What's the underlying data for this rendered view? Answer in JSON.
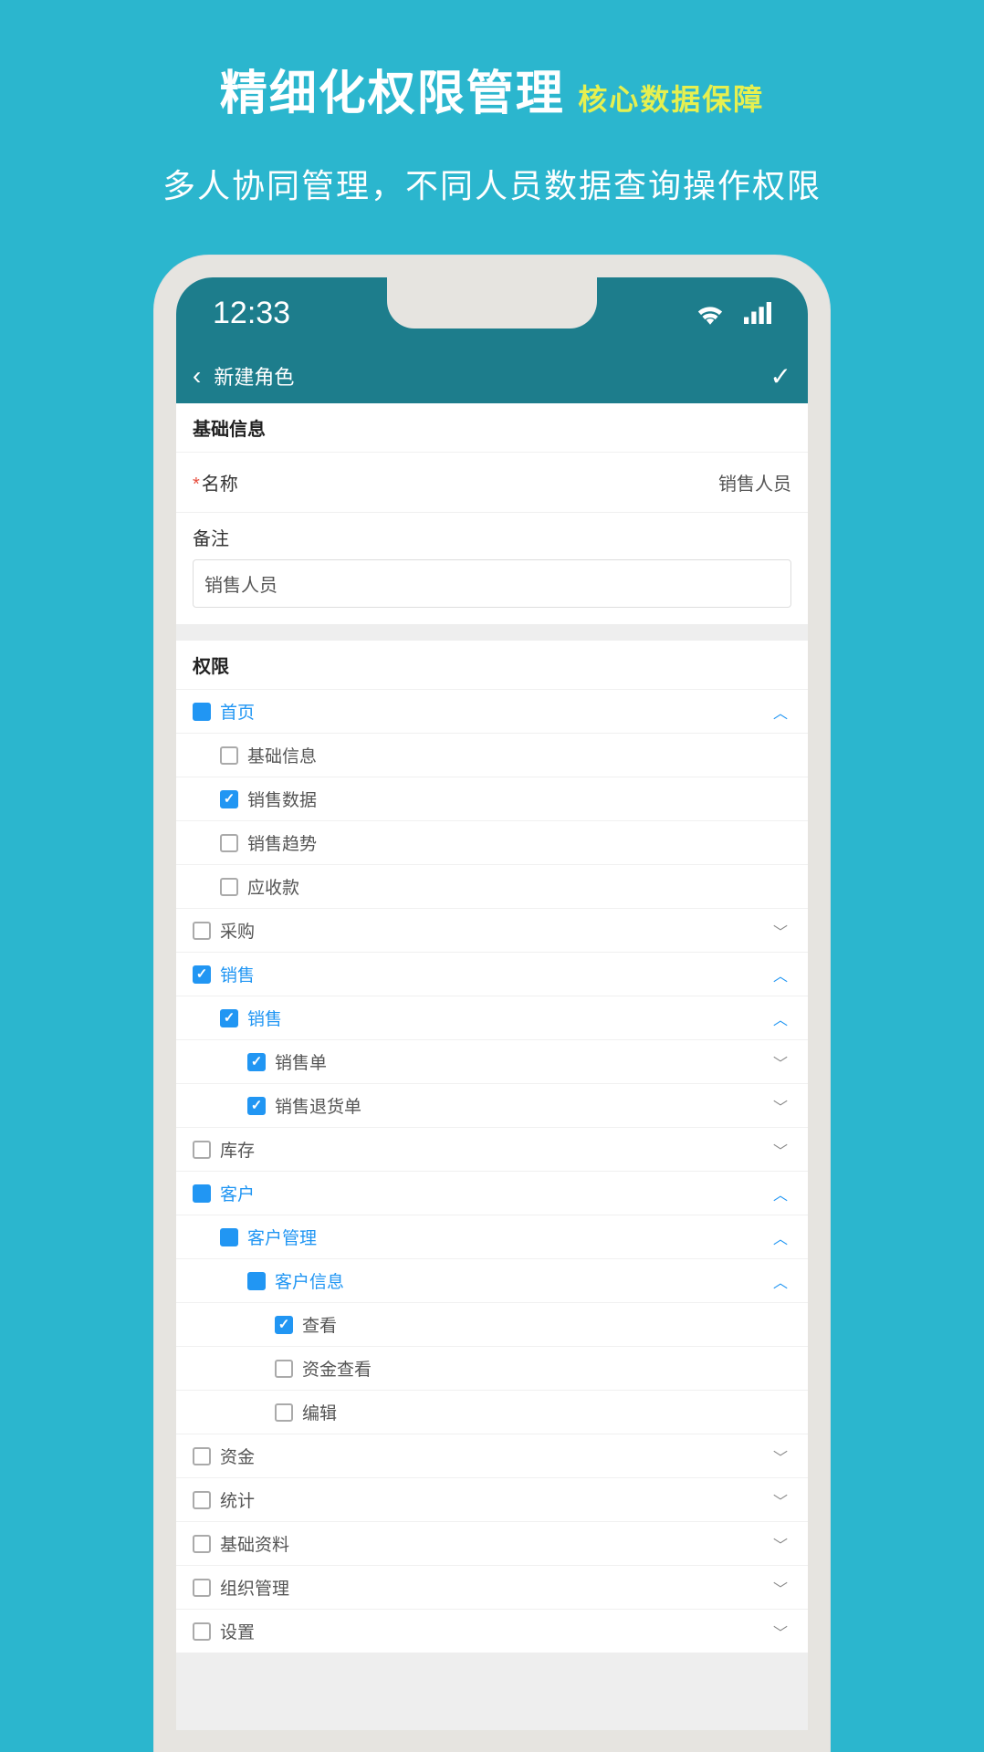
{
  "marketing": {
    "title_main": "精细化权限管理",
    "title_sub": "核心数据保障",
    "desc": "多人协同管理，不同人员数据查询操作权限"
  },
  "status": {
    "time": "12:33"
  },
  "nav": {
    "title": "新建角色"
  },
  "basic": {
    "header": "基础信息",
    "name_label": "名称",
    "name_value": "销售人员",
    "remark_label": "备注",
    "remark_value": "销售人员"
  },
  "perm_header": "权限",
  "tree": [
    {
      "id": "home",
      "level": 0,
      "label": "首页",
      "state": "square",
      "color": "blue",
      "expand": "up",
      "caretColor": "up"
    },
    {
      "id": "basicinfo",
      "level": 1,
      "label": "基础信息",
      "state": "empty",
      "color": "gray",
      "expand": "none"
    },
    {
      "id": "salesdata",
      "level": 1,
      "label": "销售数据",
      "state": "checked",
      "color": "gray",
      "expand": "none"
    },
    {
      "id": "salestrend",
      "level": 1,
      "label": "销售趋势",
      "state": "empty",
      "color": "gray",
      "expand": "none"
    },
    {
      "id": "receivable",
      "level": 1,
      "label": "应收款",
      "state": "empty",
      "color": "gray",
      "expand": "none"
    },
    {
      "id": "purchase",
      "level": 0,
      "label": "采购",
      "state": "empty",
      "color": "gray",
      "expand": "down",
      "caretColor": "down"
    },
    {
      "id": "sales",
      "level": 0,
      "label": "销售",
      "state": "checked",
      "color": "blue",
      "expand": "up",
      "caretColor": "up"
    },
    {
      "id": "sales2",
      "level": 1,
      "label": "销售",
      "state": "checked",
      "color": "blue",
      "expand": "up",
      "caretColor": "up"
    },
    {
      "id": "salesorder",
      "level": 2,
      "label": "销售单",
      "state": "checked",
      "color": "gray",
      "expand": "down",
      "caretColor": "down"
    },
    {
      "id": "salesreturn",
      "level": 2,
      "label": "销售退货单",
      "state": "checked",
      "color": "gray",
      "expand": "down",
      "caretColor": "down"
    },
    {
      "id": "stock",
      "level": 0,
      "label": "库存",
      "state": "empty",
      "color": "gray",
      "expand": "down",
      "caretColor": "down"
    },
    {
      "id": "customer",
      "level": 0,
      "label": "客户",
      "state": "square",
      "color": "blue",
      "expand": "up",
      "caretColor": "up"
    },
    {
      "id": "custmgr",
      "level": 1,
      "label": "客户管理",
      "state": "square",
      "color": "blue",
      "expand": "up",
      "caretColor": "up"
    },
    {
      "id": "custinfo",
      "level": 2,
      "label": "客户信息",
      "state": "square",
      "color": "blue",
      "expand": "up",
      "caretColor": "up"
    },
    {
      "id": "view",
      "level": 3,
      "label": "查看",
      "state": "checked",
      "color": "gray",
      "expand": "none"
    },
    {
      "id": "fundview",
      "level": 3,
      "label": "资金查看",
      "state": "empty",
      "color": "gray",
      "expand": "none"
    },
    {
      "id": "edit",
      "level": 3,
      "label": "编辑",
      "state": "empty",
      "color": "gray",
      "expand": "none"
    },
    {
      "id": "fund",
      "level": 0,
      "label": "资金",
      "state": "empty",
      "color": "gray",
      "expand": "down",
      "caretColor": "down"
    },
    {
      "id": "stats",
      "level": 0,
      "label": "统计",
      "state": "empty",
      "color": "gray",
      "expand": "down",
      "caretColor": "down"
    },
    {
      "id": "basedata",
      "level": 0,
      "label": "基础资料",
      "state": "empty",
      "color": "gray",
      "expand": "down",
      "caretColor": "down"
    },
    {
      "id": "orgmgr",
      "level": 0,
      "label": "组织管理",
      "state": "empty",
      "color": "gray",
      "expand": "down",
      "caretColor": "down"
    },
    {
      "id": "settings",
      "level": 0,
      "label": "设置",
      "state": "empty",
      "color": "gray",
      "expand": "down",
      "caretColor": "down"
    }
  ]
}
